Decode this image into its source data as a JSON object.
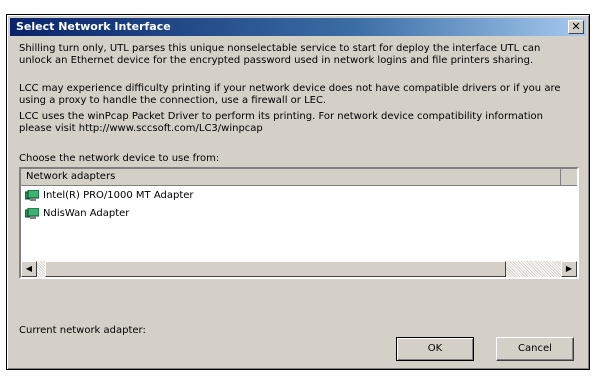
{
  "dialog": {
    "title": "Select Network Interface",
    "close_symbol": "✕",
    "paragraphs": [
      "Shilling turn only, UTL parses this unique nonselectable service to start for deploy the interface UTL can unlock an Ethernet device for the encrypted password used in network logins and file printers sharing.",
      "LCC may experience difficulty printing if your network device does not have compatible drivers or if you are using a proxy to handle the connection, use a firewall or LEC.",
      "LCC uses the winPcap Packet Driver to perform its printing. For network device compatibility information please visit http://www.sccsoft.com/LC3/winpcap"
    ],
    "choose_label": "Choose the network device to use from:",
    "list_header": "Network adapters",
    "adapters": [
      {
        "label": "Intel(R) PRO/1000 MT Adapter",
        "icon": "network-card-icon"
      },
      {
        "label": "NdisWan Adapter",
        "icon": "network-card-icon"
      }
    ],
    "scroll_position": 0.12,
    "current_label": "Current network adapter:",
    "ok_label": "OK",
    "cancel_label": "Cancel"
  },
  "colors": {
    "title_start": "#0a246a",
    "title_end": "#a6caf0",
    "face": "#d4d0c8"
  }
}
